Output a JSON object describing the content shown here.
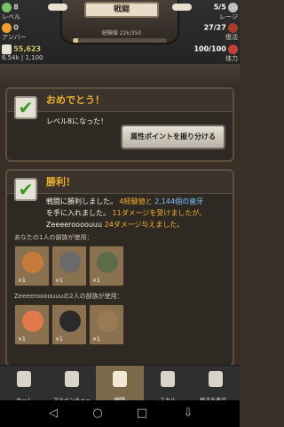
{
  "top": {
    "level_value": "8",
    "level_label": "レベル",
    "amber_value": "0",
    "amber_label": "アンバー",
    "teeth_value": "55,623",
    "teeth_sub": "6.54k | 1,100",
    "range_value": "5/5",
    "range_label": "レージ",
    "restore_value": "27/27",
    "restore_label": "復活",
    "hp_value": "100/100",
    "hp_label": "体力",
    "title": "戦闘",
    "xp_text": "経験値 22k/350",
    "xp_fraction": 0.06
  },
  "congrats": {
    "heading": "おめでとう！",
    "text": "レベル8になった！",
    "button": "属性ポイントを振り分ける"
  },
  "victory": {
    "heading": "勝利！",
    "line1_a": "戦闘に勝利しました。",
    "line1_xp": "4経験値と",
    "line1_teeth": "2,144個の歯牙",
    "line2": "を手に入れました。",
    "line2_dmg": "11ダメージを受けましたが、",
    "line3_name": "Zeeeeroooouuu",
    "line3_dmg": "24ダメージ与えました。",
    "tribe1_label": "あなたの1人の部族が使用：",
    "tribe2_label": "Zeeeeroooouuuの2人の部族が使用：",
    "tribe1_counts": [
      "×1",
      "×1",
      "×1"
    ],
    "tribe2_counts": [
      "×1",
      "×1",
      "×1"
    ]
  },
  "tabs": [
    {
      "label": "ホーム"
    },
    {
      "label": "アドベンチャー"
    },
    {
      "label": "戦闘"
    },
    {
      "label": "スキル"
    },
    {
      "label": "続きを表示..."
    }
  ]
}
